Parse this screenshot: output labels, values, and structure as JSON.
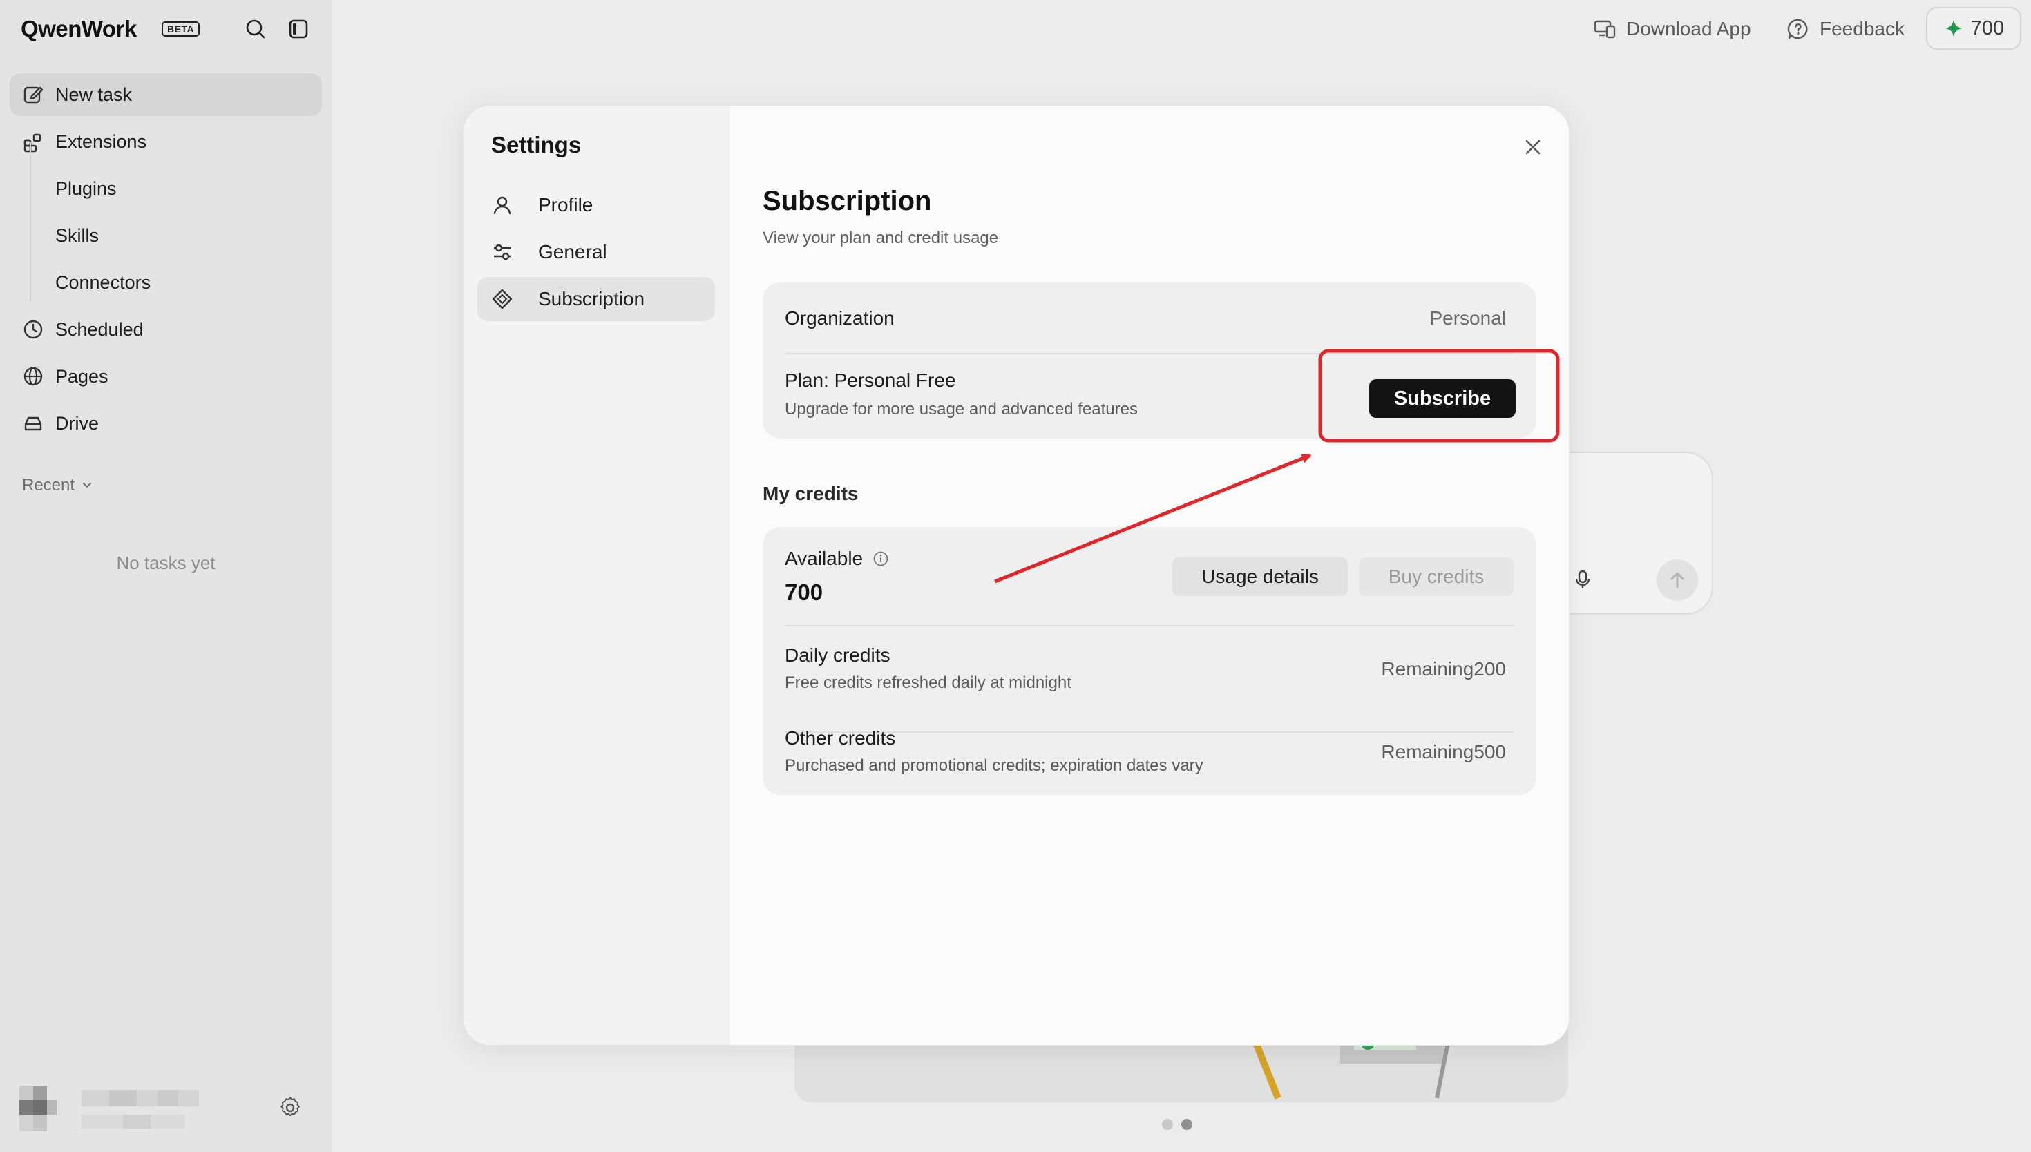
{
  "app": {
    "name": "QwenWork",
    "badge": "BETA"
  },
  "sidebar": {
    "items": [
      {
        "label": "New task",
        "icon": "edit-icon"
      },
      {
        "label": "Extensions",
        "icon": "extensions-icon"
      },
      {
        "label": "Plugins"
      },
      {
        "label": "Skills"
      },
      {
        "label": "Connectors"
      },
      {
        "label": "Scheduled",
        "icon": "clock-icon"
      },
      {
        "label": "Pages",
        "icon": "globe-icon"
      },
      {
        "label": "Drive",
        "icon": "drive-icon"
      }
    ],
    "recent_label": "Recent",
    "empty_text": "No tasks yet"
  },
  "topbar": {
    "download_label": "Download App",
    "feedback_label": "Feedback",
    "credits": "700"
  },
  "settings": {
    "title": "Settings",
    "nav": [
      {
        "label": "Profile",
        "icon": "person-icon"
      },
      {
        "label": "General",
        "icon": "sliders-icon"
      },
      {
        "label": "Subscription",
        "icon": "diamond-icon",
        "active": true
      }
    ],
    "subscription": {
      "title": "Subscription",
      "description": "View your plan and credit usage",
      "organization_label": "Organization",
      "organization_value": "Personal",
      "plan_name": "Plan: Personal Free",
      "plan_desc": "Upgrade for more usage and advanced features",
      "subscribe_label": "Subscribe"
    },
    "credits": {
      "heading": "My credits",
      "available_label": "Available",
      "available_value": "700",
      "usage_details_label": "Usage details",
      "buy_credits_label": "Buy credits",
      "daily_title": "Daily credits",
      "daily_desc": "Free credits refreshed daily at midnight",
      "daily_remaining": "Remaining200",
      "other_title": "Other credits",
      "other_desc": "Purchased and promotional credits; expiration dates vary",
      "other_remaining": "Remaining500"
    }
  },
  "colors": {
    "annotation": "#e0262a",
    "accent_green": "#1e9a4a",
    "primary_button": "#141414"
  }
}
